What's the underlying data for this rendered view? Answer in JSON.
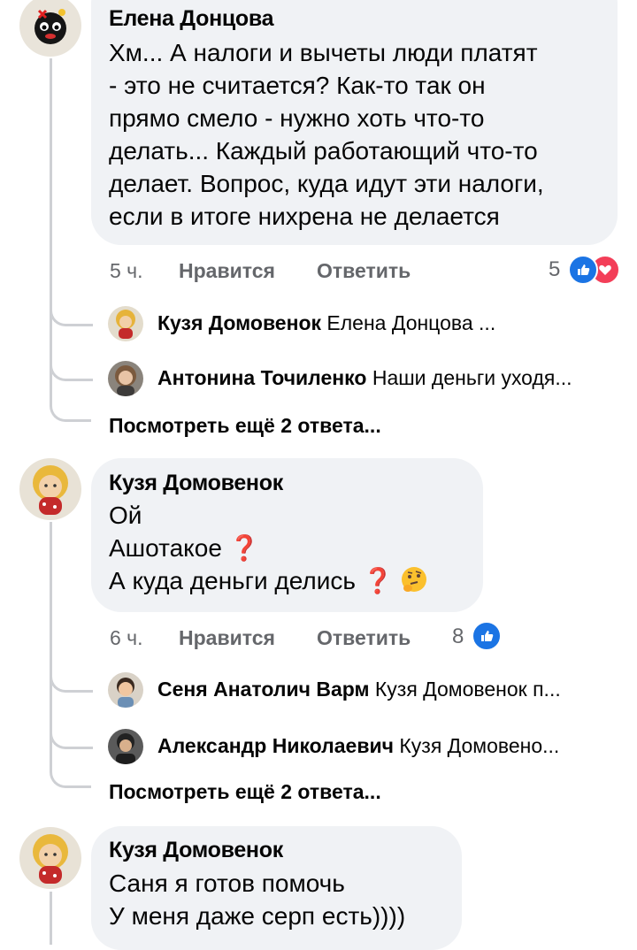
{
  "comments": [
    {
      "author": "Елена Донцова",
      "lines": [
        "Хм... А налоги и вычеты люди платят",
        "- это не считается? Как-то так он",
        "прямо смело - нужно хоть что-то",
        "делать... Каждый работающий что-то",
        "делает. Вопрос, куда идут эти налоги,",
        "если в итоге нихрена не делается"
      ],
      "time": "5 ч.",
      "like_label": "Нравится",
      "reply_label": "Ответить",
      "reaction_count": "5",
      "reactions": [
        "like-icon",
        "love-icon"
      ],
      "replies": [
        {
          "name": "Кузя Домовенок",
          "text": "Елена Донцова ..."
        },
        {
          "name": "Антонина Точиленко",
          "text": "Наши деньги уходя..."
        }
      ],
      "more_replies": "Посмотреть ещё 2 ответа..."
    },
    {
      "author": "Кузя Домовенок",
      "lines": [
        "Ой",
        "Ашотакое",
        "А куда деньги делись"
      ],
      "time": "6 ч.",
      "like_label": "Нравится",
      "reply_label": "Ответить",
      "reaction_count": "8",
      "reactions": [
        "like-icon"
      ],
      "replies": [
        {
          "name": "Сеня Анатолич Варм",
          "text": "Кузя Домовенок п..."
        },
        {
          "name": "Александр Николаевич",
          "text": "Кузя Домовено..."
        }
      ],
      "more_replies": "Посмотреть ещё 2 ответа..."
    },
    {
      "author": "Кузя Домовенок",
      "lines": [
        "Саня я готов помочь",
        "У меня даже серп есть))))"
      ]
    }
  ],
  "colors": {
    "bubble": "#f0f2f5",
    "secondary_text": "#65676b",
    "like_blue": "#1b74e4",
    "love_red": "#f33e58",
    "thread_line": "#ced0d4"
  }
}
